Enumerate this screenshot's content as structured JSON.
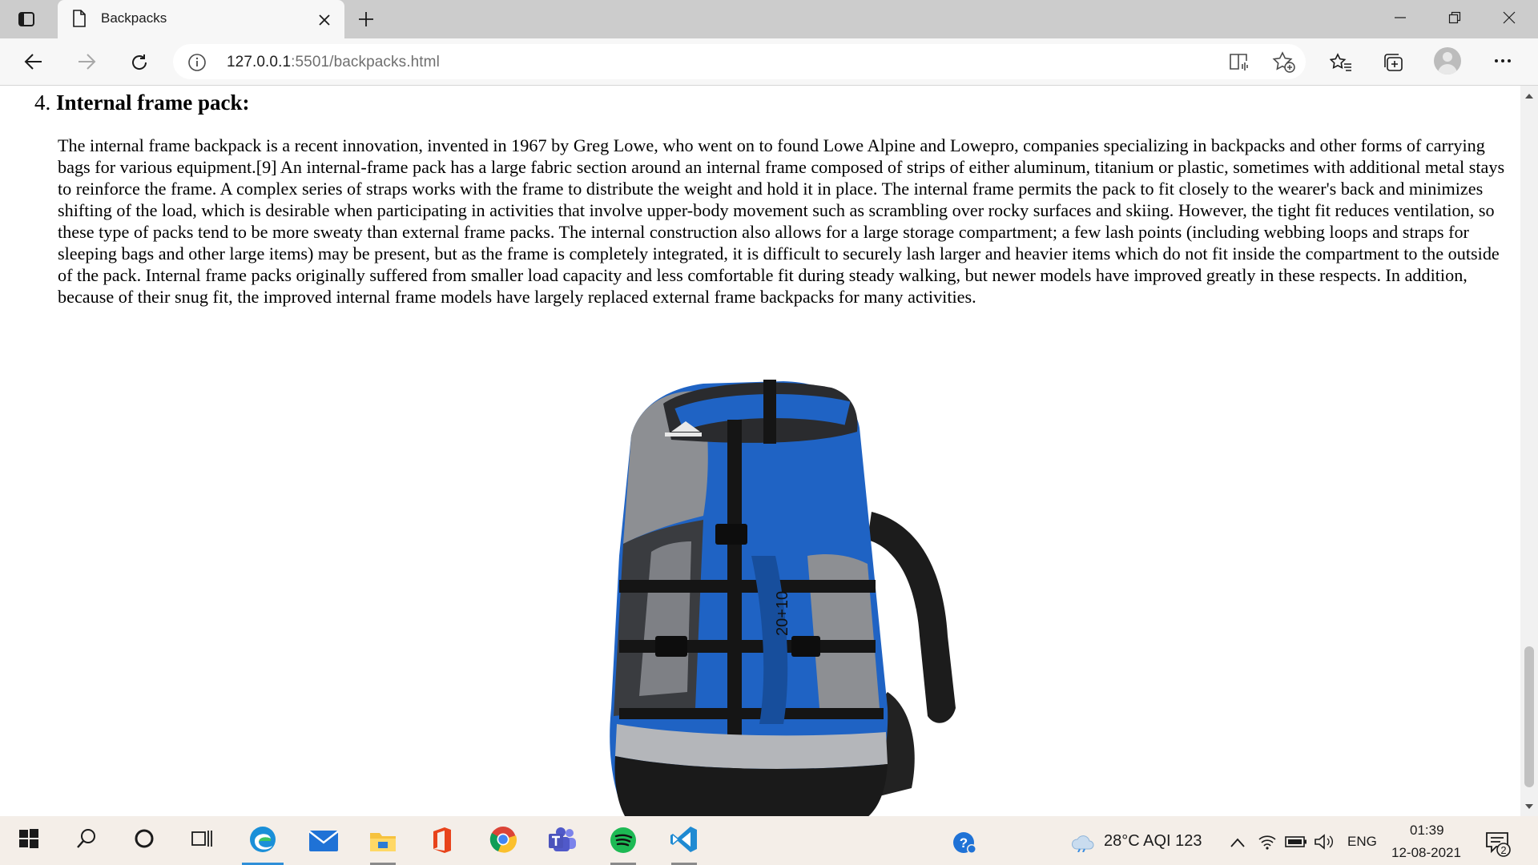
{
  "browser": {
    "tab": {
      "title": "Backpacks"
    },
    "address": {
      "host": "127.0.0.1",
      "path": ":5501/backpacks.html"
    }
  },
  "content": {
    "heading_number": "4.",
    "heading": "Internal frame pack:",
    "paragraph": "The internal frame backpack is a recent innovation, invented in 1967 by Greg Lowe, who went on to found Lowe Alpine and Lowepro, companies specializing in backpacks and other forms of carrying bags for various equipment.[9] An internal-frame pack has a large fabric section around an internal frame composed of strips of either aluminum, titanium or plastic, sometimes with additional metal stays to reinforce the frame. A complex series of straps works with the frame to distribute the weight and hold it in place. The internal frame permits the pack to fit closely to the wearer's back and minimizes shifting of the load, which is desirable when participating in activities that involve upper-body movement such as scrambling over rocky surfaces and skiing. However, the tight fit reduces ventilation, so these type of packs tend to be more sweaty than external frame packs. The internal construction also allows for a large storage compartment; a few lash points (including webbing loops and straps for sleeping bags and other large items) may be present, but as the frame is completely integrated, it is difficult to securely lash larger and heavier items which do not fit inside the compartment to the outside of the pack. Internal frame packs originally suffered from smaller load capacity and less comfortable fit during steady walking, but newer models have improved greatly in these respects. In addition, because of their snug fit, the improved internal frame models have largely replaced external frame backpacks for many activities.",
    "image_print": "20+10"
  },
  "taskbar": {
    "weather": "28°C  AQI 123",
    "language": "ENG",
    "time": "01:39",
    "date": "12-08-2021",
    "notification_count": "2",
    "icons": [
      "windows-start-icon",
      "search-icon",
      "cortana-icon",
      "task-view-icon",
      "edge-icon",
      "mail-icon",
      "file-explorer-icon",
      "office-icon",
      "chrome-icon",
      "teams-icon",
      "spotify-icon",
      "vscode-icon",
      "help-icon",
      "weather-icon",
      "chevron-up-icon",
      "wifi-icon",
      "battery-icon",
      "volume-icon",
      "notification-icon"
    ]
  },
  "colors": {
    "tabbar": "#cccccc",
    "toolbar": "#f7f7f7",
    "taskbar": "#f4eee8",
    "backpack_blue": "#1f63c4",
    "accent": "#2f8fd8"
  }
}
